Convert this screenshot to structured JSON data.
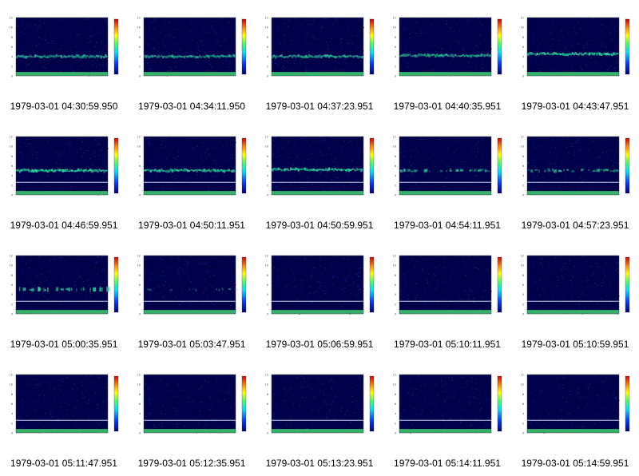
{
  "figure": {
    "colors": {
      "spectrogram_background": "#00004a",
      "band_color": "#30e0a0",
      "bright_line": "#d8f0ff",
      "low_freq_band": "#40d070"
    }
  },
  "chart_data": [
    {
      "type": "heatmap",
      "caption": "1979-03-01 04:30:59.950",
      "band_frequency_khz": 4.0,
      "band_intensity": 0.7,
      "band_style": "continuous",
      "yticks": [
        "0",
        "2",
        "4",
        "6",
        "8",
        "10",
        "12"
      ]
    },
    {
      "type": "heatmap",
      "caption": "1979-03-01 04:34:11.950",
      "band_frequency_khz": 4.0,
      "band_intensity": 0.7,
      "band_style": "continuous",
      "yticks": [
        "0",
        "2",
        "4",
        "6",
        "8",
        "10",
        "12"
      ]
    },
    {
      "type": "heatmap",
      "caption": "1979-03-01 04:37:23.951",
      "band_frequency_khz": 4.0,
      "band_intensity": 0.75,
      "band_style": "continuous",
      "yticks": [
        "0",
        "2",
        "4",
        "6",
        "8",
        "10",
        "12"
      ]
    },
    {
      "type": "heatmap",
      "caption": "1979-03-01 04:40:35.951",
      "band_frequency_khz": 4.2,
      "band_intensity": 0.7,
      "band_style": "continuous",
      "yticks": [
        "0",
        "2",
        "4",
        "6",
        "8",
        "10",
        "12"
      ]
    },
    {
      "type": "heatmap",
      "caption": "1979-03-01 04:43:47.951",
      "band_frequency_khz": 4.5,
      "band_intensity": 0.9,
      "band_style": "continuous",
      "yticks": [
        "0",
        "2",
        "4",
        "6",
        "8",
        "10",
        "12"
      ]
    },
    {
      "type": "heatmap",
      "caption": "1979-03-01 04:46:59.951",
      "band_frequency_khz": 5.0,
      "band_intensity": 0.9,
      "band_style": "continuous",
      "yticks": [
        "0",
        "2",
        "4",
        "6",
        "8",
        "10",
        "12"
      ]
    },
    {
      "type": "heatmap",
      "caption": "1979-03-01 04:50:11.951",
      "band_frequency_khz": 5.0,
      "band_intensity": 0.8,
      "band_style": "continuous",
      "yticks": [
        "0",
        "2",
        "4",
        "6",
        "8",
        "10",
        "12"
      ]
    },
    {
      "type": "heatmap",
      "caption": "1979-03-01 04:50:59.951",
      "band_frequency_khz": 5.2,
      "band_intensity": 0.85,
      "band_style": "continuous",
      "yticks": [
        "0",
        "2",
        "4",
        "6",
        "8",
        "10",
        "12"
      ]
    },
    {
      "type": "heatmap",
      "caption": "1979-03-01 04:54:11.951",
      "band_frequency_khz": 5.0,
      "band_intensity": 0.6,
      "band_style": "patchy",
      "yticks": [
        "0",
        "2",
        "4",
        "6",
        "8",
        "10",
        "12"
      ]
    },
    {
      "type": "heatmap",
      "caption": "1979-03-01 04:57:23.951",
      "band_frequency_khz": 5.0,
      "band_intensity": 0.6,
      "band_style": "patchy",
      "yticks": [
        "0",
        "2",
        "4",
        "6",
        "8",
        "10",
        "12"
      ]
    },
    {
      "type": "heatmap",
      "caption": "1979-03-01 05:00:35.951",
      "band_frequency_khz": 5.0,
      "band_intensity": 0.7,
      "band_style": "bursty",
      "yticks": [
        "0",
        "2",
        "4",
        "6",
        "8",
        "10",
        "12"
      ]
    },
    {
      "type": "heatmap",
      "caption": "1979-03-01 05:03:47.951",
      "band_frequency_khz": 5.0,
      "band_intensity": 0.3,
      "band_style": "faint",
      "yticks": [
        "0",
        "2",
        "4",
        "6",
        "8",
        "10",
        "12"
      ]
    },
    {
      "type": "heatmap",
      "caption": "1979-03-01 05:06:59.951",
      "band_frequency_khz": 0,
      "band_intensity": 0,
      "band_style": "none",
      "yticks": [
        "0",
        "2",
        "4",
        "6",
        "8",
        "10",
        "12"
      ]
    },
    {
      "type": "heatmap",
      "caption": "1979-03-01 05:10:11.951",
      "band_frequency_khz": 0,
      "band_intensity": 0,
      "band_style": "none",
      "yticks": [
        "0",
        "2",
        "4",
        "6",
        "8",
        "10",
        "12"
      ]
    },
    {
      "type": "heatmap",
      "caption": "1979-03-01 05:10:59.951",
      "band_frequency_khz": 0,
      "band_intensity": 0,
      "band_style": "none",
      "yticks": [
        "0",
        "2",
        "4",
        "6",
        "8",
        "10",
        "12"
      ]
    },
    {
      "type": "heatmap",
      "caption": "1979-03-01 05:11:47.951",
      "band_frequency_khz": 0,
      "band_intensity": 0,
      "band_style": "none",
      "yticks": [
        "0",
        "2",
        "4",
        "6",
        "8",
        "10",
        "12"
      ]
    },
    {
      "type": "heatmap",
      "caption": "1979-03-01 05:12:35.951",
      "band_frequency_khz": 0,
      "band_intensity": 0,
      "band_style": "none",
      "yticks": [
        "0",
        "2",
        "4",
        "6",
        "8",
        "10",
        "12"
      ]
    },
    {
      "type": "heatmap",
      "caption": "1979-03-01 05:13:23.951",
      "band_frequency_khz": 0,
      "band_intensity": 0,
      "band_style": "none",
      "yticks": [
        "0",
        "2",
        "4",
        "6",
        "8",
        "10",
        "12"
      ]
    },
    {
      "type": "heatmap",
      "caption": "1979-03-01 05:14:11.951",
      "band_frequency_khz": 0,
      "band_intensity": 0,
      "band_style": "none",
      "yticks": [
        "0",
        "2",
        "4",
        "6",
        "8",
        "10",
        "12"
      ]
    },
    {
      "type": "heatmap",
      "caption": "1979-03-01 05:14:59.951",
      "band_frequency_khz": 0,
      "band_intensity": 0,
      "band_style": "none",
      "yticks": [
        "0",
        "2",
        "4",
        "6",
        "8",
        "10",
        "12"
      ]
    }
  ]
}
